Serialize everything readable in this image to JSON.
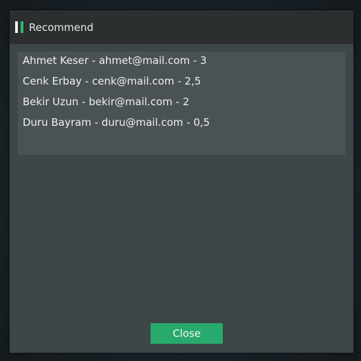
{
  "window": {
    "title": "Recommend"
  },
  "list": {
    "items": [
      {
        "label": "Ahmet Keser - ahmet@mail.com - 3"
      },
      {
        "label": "Cenk Erbay - cenk@mail.com - 2,5"
      },
      {
        "label": "Bekir Uzun - bekir@mail.com - 2"
      },
      {
        "label": "Duru Bayram - duru@mail.com - 0,5"
      }
    ]
  },
  "buttons": {
    "close_label": "Close"
  },
  "colors": {
    "accent": "#28aa6c",
    "titlebar": "#2c2f30",
    "window_bg": "#3d4648",
    "list_bg": "#4a5254"
  },
  "icons": {
    "app_icon": "app-logo-icon"
  }
}
